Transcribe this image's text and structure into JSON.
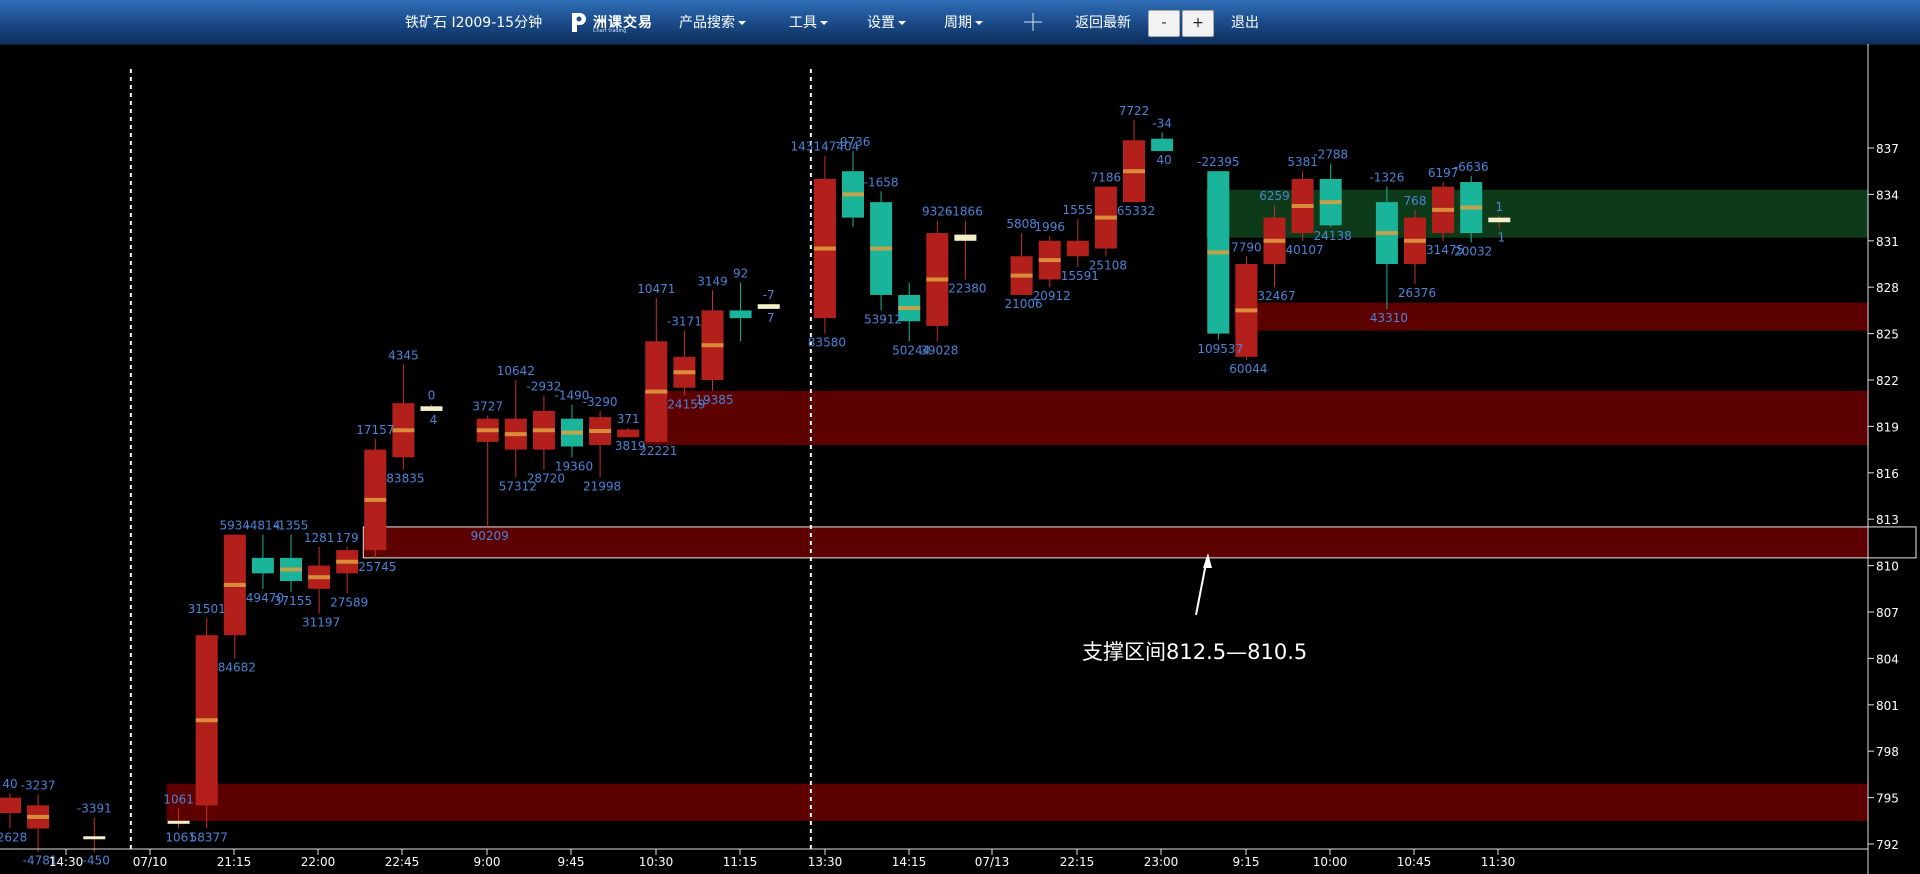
{
  "toolbar": {
    "title": "铁矿石 I2009-15分钟",
    "logo_text": "洲课交易",
    "logo_sub": "Chart trading",
    "menu_products": "产品搜索",
    "menu_tools": "工具",
    "menu_settings": "设置",
    "menu_period": "周期",
    "back_latest": "返回最新",
    "zoom_out": "-",
    "zoom_in": "+",
    "logout": "退出"
  },
  "annotation": "支撑区间812.5—810.5",
  "colors": {
    "up": "#19b49a",
    "down": "#b3201c",
    "label": "#4b83d6",
    "zone_red": "#5c0000",
    "zone_green": "#0d3a18"
  },
  "chart_data": {
    "type": "candlestick",
    "title": "铁矿石 I2009-15分钟",
    "y_ticks": [
      837,
      834,
      831,
      828,
      825,
      822,
      819,
      816,
      813,
      810,
      807,
      804,
      801,
      798,
      795,
      792
    ],
    "x_ticks": [
      "14:30",
      "07/10",
      "21:15",
      "22:00",
      "22:45",
      "9:00",
      "9:45",
      "10:30",
      "11:15",
      "13:30",
      "14:15",
      "07/13",
      "22:15",
      "23:00",
      "9:15",
      "10:00",
      "10:45",
      "11:30"
    ],
    "ylim": [
      791.5,
      839.5
    ],
    "session_separators": [
      "07/10",
      "07/13"
    ],
    "zones": [
      {
        "color": "red",
        "y1": 795.9,
        "y2": 793.5,
        "from_index": 6
      },
      {
        "color": "red",
        "y1": 812.5,
        "y2": 810.5,
        "from_index": 13,
        "outlined": true
      },
      {
        "color": "red",
        "y1": 821.3,
        "y2": 817.8,
        "from_index": 23
      },
      {
        "color": "red",
        "y1": 827.0,
        "y2": 825.2,
        "from_index": 44
      },
      {
        "color": "green",
        "y1": 834.3,
        "y2": 831.2,
        "from_index": 43
      }
    ],
    "candles": [
      {
        "i": 0,
        "o": 794.0,
        "h": 795.3,
        "l": 793.0,
        "c": 795.0,
        "vol": "40",
        "low_label": "2628"
      },
      {
        "i": 1,
        "o": 793.0,
        "h": 795.2,
        "l": 791.5,
        "c": 794.5,
        "vol": "-3237",
        "low_label": "-4781"
      },
      {
        "i": 3,
        "o": 792.5,
        "h": 793.7,
        "l": 791.5,
        "c": 792.5,
        "vol": "-3391",
        "low_label": "-450"
      },
      {
        "i": 6,
        "o": 793.5,
        "h": 794.3,
        "l": 793.0,
        "c": 793.5,
        "vol": "1061",
        "low_label": "1061"
      },
      {
        "i": 7,
        "o": 794.5,
        "h": 806.6,
        "l": 793.0,
        "c": 805.5,
        "vol": "31501",
        "low_label": "58377"
      },
      {
        "i": 8,
        "o": 805.5,
        "h": 812.0,
        "l": 804.0,
        "c": 812.0,
        "vol": "5934",
        "low_label": "84682"
      },
      {
        "i": 9,
        "o": 810.5,
        "h": 812.0,
        "l": 808.5,
        "c": 809.5,
        "vol": "-4814",
        "low_label": "49470"
      },
      {
        "i": 10,
        "o": 810.5,
        "h": 812.0,
        "l": 808.3,
        "c": 809.0,
        "vol": "-1355",
        "low_label": "37155"
      },
      {
        "i": 11,
        "o": 808.5,
        "h": 811.2,
        "l": 806.9,
        "c": 810.0,
        "vol": "1281",
        "low_label": "31197"
      },
      {
        "i": 12,
        "o": 809.5,
        "h": 811.2,
        "l": 808.2,
        "c": 811.0,
        "vol": "179",
        "low_label": "27589"
      },
      {
        "i": 13,
        "o": 811.0,
        "h": 818.2,
        "l": 810.5,
        "c": 817.5,
        "vol": "17157",
        "low_label": "25745"
      },
      {
        "i": 14,
        "o": 817.0,
        "h": 823.0,
        "l": 816.2,
        "c": 820.5,
        "vol": "4345",
        "low_label": "83835"
      },
      {
        "i": 15,
        "o": 820.0,
        "h": 820.4,
        "l": 820.0,
        "c": 820.3,
        "vol": "0",
        "low_label": "4"
      },
      {
        "i": 17,
        "o": 818.0,
        "h": 819.7,
        "l": 812.5,
        "c": 819.5,
        "vol": "3727",
        "low_label": "90209"
      },
      {
        "i": 18,
        "o": 817.5,
        "h": 822.0,
        "l": 815.7,
        "c": 819.5,
        "vol": "10642",
        "low_label": "57312"
      },
      {
        "i": 19,
        "o": 817.5,
        "h": 821.0,
        "l": 816.2,
        "c": 820.0,
        "vol": "-2932",
        "low_label": "28720"
      },
      {
        "i": 20,
        "o": 819.5,
        "h": 820.4,
        "l": 817.0,
        "c": 817.7,
        "vol": "-1490",
        "low_label": "19360"
      },
      {
        "i": 21,
        "o": 817.8,
        "h": 820.0,
        "l": 815.7,
        "c": 819.6,
        "vol": "-3290",
        "low_label": "21998"
      },
      {
        "i": 22,
        "o": 818.3,
        "h": 818.9,
        "l": 818.3,
        "c": 818.8,
        "vol": "371",
        "low_label": "3819"
      },
      {
        "i": 23,
        "o": 818.0,
        "h": 827.3,
        "l": 818.0,
        "c": 824.5,
        "vol": "10471",
        "low_label": "22221"
      },
      {
        "i": 24,
        "o": 821.5,
        "h": 825.2,
        "l": 821.0,
        "c": 823.5,
        "vol": "-3171",
        "low_label": "24159"
      },
      {
        "i": 25,
        "o": 822.0,
        "h": 827.8,
        "l": 821.3,
        "c": 826.5,
        "vol": "3149",
        "low_label": "19385"
      },
      {
        "i": 26,
        "o": 826.5,
        "h": 828.3,
        "l": 824.5,
        "c": 826.0,
        "vol": "92",
        "low_label": ""
      },
      {
        "i": 27,
        "o": 826.6,
        "h": 826.9,
        "l": 826.6,
        "c": 826.9,
        "vol": "-7",
        "low_label": "7"
      },
      {
        "i": 29,
        "o": 826.0,
        "h": 836.5,
        "l": 825.0,
        "c": 835.0,
        "vol": "143147404",
        "low_label": "83580"
      },
      {
        "i": 30,
        "o": 835.5,
        "h": 836.8,
        "l": 831.9,
        "c": 832.5,
        "vol": "-9736",
        "low_label": ""
      },
      {
        "i": 31,
        "o": 833.5,
        "h": 834.2,
        "l": 826.5,
        "c": 827.5,
        "vol": "-1658",
        "low_label": "53912"
      },
      {
        "i": 32,
        "o": 827.5,
        "h": 828.3,
        "l": 824.5,
        "c": 825.8,
        "vol": "",
        "low_label": "50244"
      },
      {
        "i": 33,
        "o": 825.5,
        "h": 832.3,
        "l": 824.5,
        "c": 831.5,
        "vol": "9326",
        "low_label": "39028"
      },
      {
        "i": 34,
        "o": 831.0,
        "h": 832.3,
        "l": 828.5,
        "c": 831.4,
        "vol": "-1866",
        "low_label": "22380"
      },
      {
        "i": 36,
        "o": 827.5,
        "h": 831.5,
        "l": 827.5,
        "c": 830.0,
        "vol": "5808",
        "low_label": "21006"
      },
      {
        "i": 37,
        "o": 828.5,
        "h": 831.3,
        "l": 828.0,
        "c": 831.0,
        "vol": "1996",
        "low_label": "20912"
      },
      {
        "i": 38,
        "o": 830.0,
        "h": 832.4,
        "l": 829.3,
        "c": 831.0,
        "vol": "1555",
        "low_label": "15591"
      },
      {
        "i": 39,
        "o": 830.5,
        "h": 834.5,
        "l": 830.0,
        "c": 834.5,
        "vol": "7186",
        "low_label": "25108"
      },
      {
        "i": 40,
        "o": 833.5,
        "h": 838.8,
        "l": 833.5,
        "c": 837.5,
        "vol": "7722",
        "low_label": "65332"
      },
      {
        "i": 41,
        "o": 837.6,
        "h": 838.0,
        "l": 836.8,
        "c": 836.8,
        "vol": "-34",
        "low_label": "40"
      },
      {
        "i": 43,
        "o": 835.5,
        "h": 835.5,
        "l": 824.6,
        "c": 825.0,
        "vol": "-22395",
        "low_label": "109537"
      },
      {
        "i": 44,
        "o": 823.5,
        "h": 830.0,
        "l": 823.3,
        "c": 829.5,
        "vol": "7790",
        "low_label": "60044"
      },
      {
        "i": 45,
        "o": 829.5,
        "h": 833.3,
        "l": 828.0,
        "c": 832.5,
        "vol": "6259",
        "low_label": "32467"
      },
      {
        "i": 46,
        "o": 831.5,
        "h": 835.5,
        "l": 831.0,
        "c": 835.0,
        "vol": "5381",
        "low_label": "40107"
      },
      {
        "i": 47,
        "o": 835.0,
        "h": 836.0,
        "l": 831.9,
        "c": 832.0,
        "vol": "-2788",
        "low_label": "24138"
      },
      {
        "i": 49,
        "o": 833.5,
        "h": 834.5,
        "l": 826.6,
        "c": 829.5,
        "vol": "-1326",
        "low_label": "43310"
      },
      {
        "i": 50,
        "o": 829.5,
        "h": 833.0,
        "l": 828.2,
        "c": 832.5,
        "vol": "768",
        "low_label": "26376"
      },
      {
        "i": 51,
        "o": 831.5,
        "h": 834.8,
        "l": 831.0,
        "c": 834.5,
        "vol": "6197",
        "low_label": "31475"
      },
      {
        "i": 52,
        "o": 834.8,
        "h": 835.2,
        "l": 830.9,
        "c": 831.5,
        "vol": "-6636",
        "low_label": "20032"
      },
      {
        "i": 53,
        "o": 832.2,
        "h": 832.6,
        "l": 831.8,
        "c": 832.5,
        "vol": "1",
        "low_label": "1"
      }
    ]
  }
}
